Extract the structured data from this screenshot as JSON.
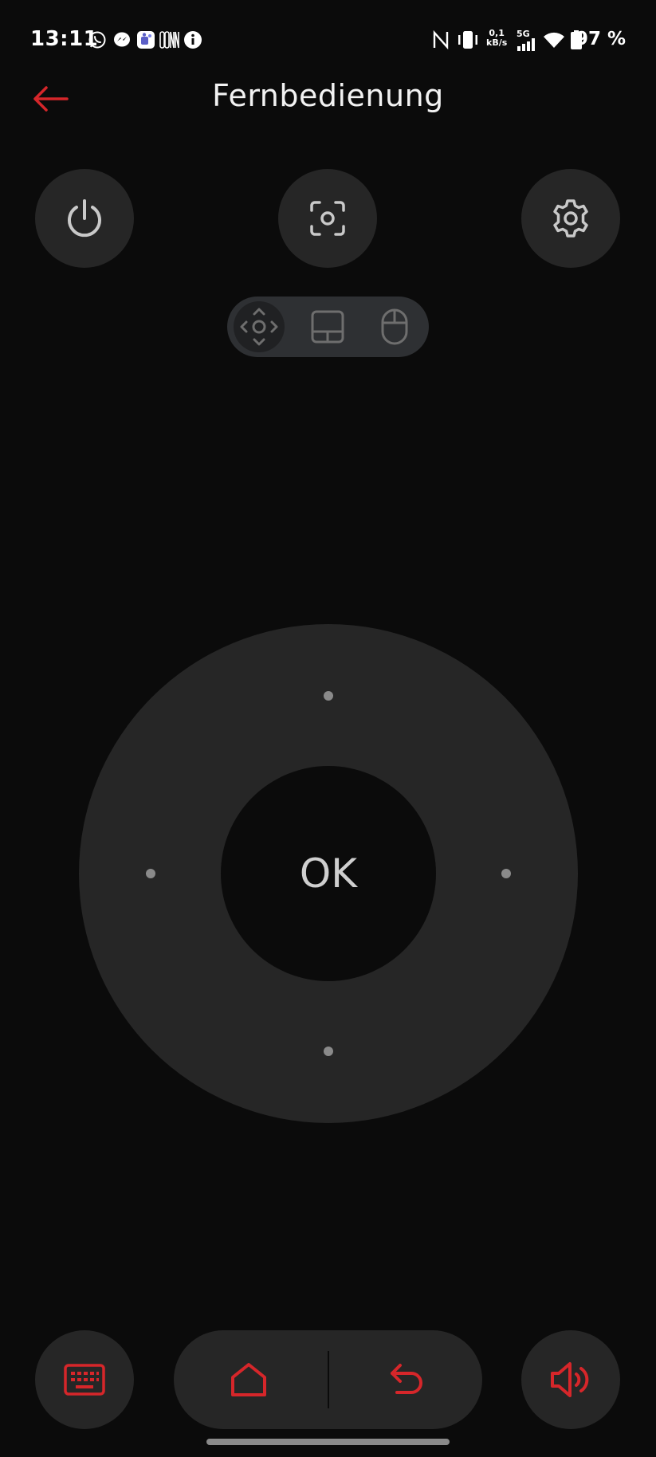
{
  "status_bar": {
    "time": "13:11",
    "net_speed_value": "0,1",
    "net_speed_unit": "kB/s",
    "network_type": "5G",
    "battery": "97 %",
    "notification_icons": [
      "whatsapp-icon",
      "messenger-icon",
      "teams-icon",
      "oonn-icon",
      "info-icon"
    ],
    "system_icons": [
      "nfc-icon",
      "vibrate-icon",
      "signal-icon",
      "wifi-icon",
      "battery-icon"
    ]
  },
  "app_bar": {
    "title": "Fernbedienung",
    "back_icon": "arrow-left-icon"
  },
  "top_actions": [
    {
      "name": "power",
      "icon": "power-icon"
    },
    {
      "name": "screenshot",
      "icon": "screenshot-icon"
    },
    {
      "name": "settings",
      "icon": "gear-icon"
    }
  ],
  "mode_toggle": {
    "options": [
      "dpad",
      "touchpad",
      "mouse"
    ],
    "selected": "dpad"
  },
  "dpad": {
    "ok_label": "OK"
  },
  "bottom_bar": {
    "keyboard_icon": "keyboard-icon",
    "home_icon": "home-icon",
    "return_icon": "return-icon",
    "volume_icon": "volume-icon"
  },
  "colors": {
    "background": "#0b0b0b",
    "button": "#262626",
    "accent": "#d6262a",
    "icon_light": "#c9c9c9",
    "icon_dim": "#6e6e6e"
  }
}
